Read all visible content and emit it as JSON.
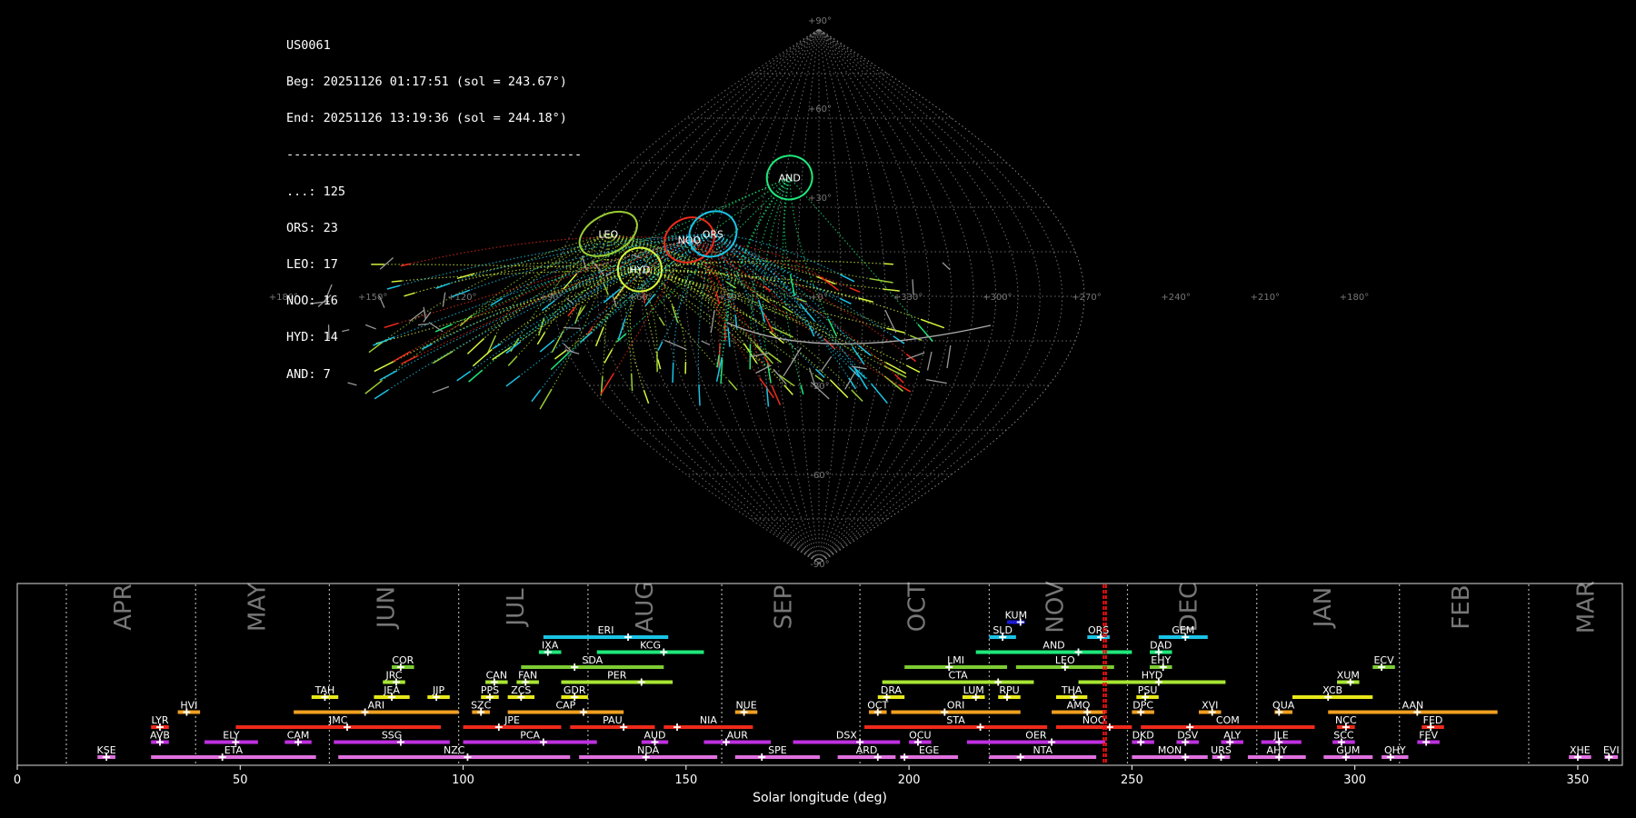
{
  "summary": {
    "station": "US0061",
    "begin": "Beg: 20251126 01:17:51 (sol = 243.67°)",
    "end": "End: 20251126 13:19:36 (sol = 244.18°)",
    "separator": "----------------------------------------",
    "counts": [
      "...: 125",
      "ORS: 23",
      "LEO: 17",
      "NOO: 16",
      "HYD: 14",
      "AND: 7"
    ]
  },
  "chart_data": [
    {
      "type": "scatter",
      "projection": "sinusoidal",
      "grid": true,
      "lon_ticks": [
        "+180°",
        "+150°",
        "+120°",
        "+90°",
        "+60°",
        "+30°",
        "+0°",
        "+330°",
        "+300°",
        "+270°",
        "+240°",
        "+210°",
        "+180°"
      ],
      "lat_ticks": [
        "+90°",
        "+60°",
        "+30°",
        "-30°",
        "-60°",
        "-90°"
      ],
      "colors": {
        "LEO": "#9acd32",
        "HYD": "#d4f53c",
        "NOO": "#ee2a1b",
        "ORS": "#19c4e6",
        "AND": "#1ee87a",
        "sporadic": "#999999"
      },
      "radiants": [
        {
          "code": "LEO",
          "lon": 153,
          "lat": 21
        },
        {
          "code": "HYD",
          "lon": 123,
          "lat": 9
        },
        {
          "code": "NOO",
          "lon": 93,
          "lat": 19
        },
        {
          "code": "ORS",
          "lon": 77,
          "lat": 21
        },
        {
          "code": "AND",
          "lon": 26,
          "lat": 40
        }
      ]
    },
    {
      "type": "bar",
      "title": "",
      "xlabel": "Solar longitude (deg)",
      "ylabel": "",
      "xlim": [
        0,
        360
      ],
      "xticks": [
        0,
        50,
        100,
        150,
        200,
        250,
        300,
        350
      ],
      "current_sol": [
        243.67,
        244.18
      ],
      "months": [
        {
          "name": "APR",
          "lon": 24
        },
        {
          "name": "MAY",
          "lon": 54
        },
        {
          "name": "JUN",
          "lon": 83
        },
        {
          "name": "JUL",
          "lon": 112
        },
        {
          "name": "AUG",
          "lon": 141
        },
        {
          "name": "SEP",
          "lon": 172
        },
        {
          "name": "OCT",
          "lon": 202
        },
        {
          "name": "NOV",
          "lon": 233
        },
        {
          "name": "DEC",
          "lon": 263
        },
        {
          "name": "JAN",
          "lon": 293
        },
        {
          "name": "FEB",
          "lon": 324
        },
        {
          "name": "MAR",
          "lon": 352
        }
      ],
      "month_boundaries": [
        11,
        40,
        70,
        99,
        128,
        158,
        189,
        218,
        249,
        278,
        310,
        339
      ],
      "showers": [
        {
          "code": "KUM",
          "start": 222,
          "end": 226,
          "peak": 225,
          "row": 9,
          "color": "#1a1ad8"
        },
        {
          "code": "ERI",
          "start": 118,
          "end": 146,
          "peak": 137,
          "row": 8,
          "color": "#19c4e6"
        },
        {
          "code": "SLD",
          "start": 218,
          "end": 224,
          "peak": 221,
          "row": 8,
          "color": "#19c4e6"
        },
        {
          "code": "ORS",
          "start": 240,
          "end": 245,
          "peak": 243,
          "row": 8,
          "color": "#19c4e6"
        },
        {
          "code": "GEM",
          "start": 256,
          "end": 267,
          "peak": 262,
          "row": 8,
          "color": "#19c4e6"
        },
        {
          "code": "IXA",
          "start": 117,
          "end": 122,
          "peak": 119,
          "row": 7,
          "color": "#1ee87a"
        },
        {
          "code": "KCG",
          "start": 130,
          "end": 154,
          "peak": 145,
          "row": 7,
          "color": "#1ee87a"
        },
        {
          "code": "AND",
          "start": 215,
          "end": 250,
          "peak": 238,
          "row": 7,
          "color": "#1ee87a"
        },
        {
          "code": "DAD",
          "start": 254,
          "end": 259,
          "peak": 256,
          "row": 7,
          "color": "#1ee87a"
        },
        {
          "code": "COR",
          "start": 84,
          "end": 89,
          "peak": 86,
          "row": 6,
          "color": "#7ccd32"
        },
        {
          "code": "SDA",
          "start": 113,
          "end": 145,
          "peak": 125,
          "row": 6,
          "color": "#7ccd32"
        },
        {
          "code": "LMI",
          "start": 199,
          "end": 222,
          "peak": 209,
          "row": 6,
          "color": "#7ccd32"
        },
        {
          "code": "LEO",
          "start": 224,
          "end": 246,
          "peak": 235,
          "row": 6,
          "color": "#7ccd32"
        },
        {
          "code": "EHY",
          "start": 254,
          "end": 259,
          "peak": 257,
          "row": 6,
          "color": "#7ccd32"
        },
        {
          "code": "ECV",
          "start": 304,
          "end": 309,
          "peak": 306,
          "row": 6,
          "color": "#7ccd32"
        },
        {
          "code": "JRC",
          "start": 82,
          "end": 87,
          "peak": 85,
          "row": 5,
          "color": "#a8e632"
        },
        {
          "code": "CAN",
          "start": 105,
          "end": 110,
          "peak": 107,
          "row": 5,
          "color": "#a8e632"
        },
        {
          "code": "FAN",
          "start": 112,
          "end": 117,
          "peak": 114,
          "row": 5,
          "color": "#a8e632"
        },
        {
          "code": "PER",
          "start": 122,
          "end": 147,
          "peak": 140,
          "row": 5,
          "color": "#a8e632"
        },
        {
          "code": "CTA",
          "start": 194,
          "end": 228,
          "peak": 220,
          "row": 5,
          "color": "#a8e632"
        },
        {
          "code": "HYD",
          "start": 238,
          "end": 271,
          "peak": 256,
          "row": 5,
          "color": "#a8e632"
        },
        {
          "code": "XUM",
          "start": 296,
          "end": 301,
          "peak": 299,
          "row": 5,
          "color": "#a8e632"
        },
        {
          "code": "TAH",
          "start": 66,
          "end": 72,
          "peak": 69,
          "row": 4,
          "color": "#e8e81a"
        },
        {
          "code": "JEA",
          "start": 80,
          "end": 88,
          "peak": 84,
          "row": 4,
          "color": "#e8e81a"
        },
        {
          "code": "JIP",
          "start": 92,
          "end": 97,
          "peak": 94,
          "row": 4,
          "color": "#e8e81a"
        },
        {
          "code": "PPS",
          "start": 104,
          "end": 108,
          "peak": 106,
          "row": 4,
          "color": "#e8e81a"
        },
        {
          "code": "ZCS",
          "start": 110,
          "end": 116,
          "peak": 113,
          "row": 4,
          "color": "#e8e81a"
        },
        {
          "code": "GDR",
          "start": 122,
          "end": 128,
          "peak": 125,
          "row": 4,
          "color": "#e8e81a"
        },
        {
          "code": "DRA",
          "start": 193,
          "end": 199,
          "peak": 195,
          "row": 4,
          "color": "#e8e81a"
        },
        {
          "code": "LUM",
          "start": 212,
          "end": 217,
          "peak": 215,
          "row": 4,
          "color": "#e8e81a"
        },
        {
          "code": "RPU",
          "start": 220,
          "end": 225,
          "peak": 222,
          "row": 4,
          "color": "#e8e81a"
        },
        {
          "code": "THA",
          "start": 233,
          "end": 240,
          "peak": 237,
          "row": 4,
          "color": "#e8e81a"
        },
        {
          "code": "PSU",
          "start": 251,
          "end": 256,
          "peak": 253,
          "row": 4,
          "color": "#e8e81a"
        },
        {
          "code": "XCB",
          "start": 286,
          "end": 304,
          "peak": 294,
          "row": 4,
          "color": "#e8e81a"
        },
        {
          "code": "HVI",
          "start": 36,
          "end": 41,
          "peak": 38,
          "row": 3,
          "color": "#f0a020"
        },
        {
          "code": "ARI",
          "start": 62,
          "end": 99,
          "peak": 78,
          "row": 3,
          "color": "#f0a020"
        },
        {
          "code": "SZC",
          "start": 102,
          "end": 106,
          "peak": 104,
          "row": 3,
          "color": "#f0a020"
        },
        {
          "code": "CAP",
          "start": 110,
          "end": 136,
          "peak": 127,
          "row": 3,
          "color": "#f0a020"
        },
        {
          "code": "NUE",
          "start": 161,
          "end": 166,
          "peak": 163,
          "row": 3,
          "color": "#f0a020"
        },
        {
          "code": "OCT",
          "start": 191,
          "end": 195,
          "peak": 193,
          "row": 3,
          "color": "#f0a020"
        },
        {
          "code": "ORI",
          "start": 196,
          "end": 225,
          "peak": 208,
          "row": 3,
          "color": "#f0a020"
        },
        {
          "code": "AMO",
          "start": 232,
          "end": 244,
          "peak": 240,
          "row": 3,
          "color": "#f0a020"
        },
        {
          "code": "DPC",
          "start": 250,
          "end": 255,
          "peak": 252,
          "row": 3,
          "color": "#f0a020"
        },
        {
          "code": "XVI",
          "start": 265,
          "end": 270,
          "peak": 268,
          "row": 3,
          "color": "#f0a020"
        },
        {
          "code": "QUA",
          "start": 282,
          "end": 286,
          "peak": 283,
          "row": 3,
          "color": "#f0a020"
        },
        {
          "code": "AAN",
          "start": 294,
          "end": 332,
          "peak": 314,
          "row": 3,
          "color": "#f0a020"
        },
        {
          "code": "LYR",
          "start": 30,
          "end": 34,
          "peak": 32,
          "row": 2,
          "color": "#ee2a1b"
        },
        {
          "code": "JMC",
          "start": 49,
          "end": 95,
          "peak": 74,
          "row": 2,
          "color": "#ee2a1b"
        },
        {
          "code": "JPE",
          "start": 100,
          "end": 122,
          "peak": 108,
          "row": 2,
          "color": "#ee2a1b"
        },
        {
          "code": "PAU",
          "start": 124,
          "end": 143,
          "peak": 136,
          "row": 2,
          "color": "#ee2a1b"
        },
        {
          "code": "NIA",
          "start": 145,
          "end": 165,
          "peak": 148,
          "row": 2,
          "color": "#ee2a1b"
        },
        {
          "code": "STA",
          "start": 190,
          "end": 231,
          "peak": 216,
          "row": 2,
          "color": "#ee2a1b"
        },
        {
          "code": "NOO",
          "start": 233,
          "end": 250,
          "peak": 245,
          "row": 2,
          "color": "#ee2a1b"
        },
        {
          "code": "COM",
          "start": 252,
          "end": 291,
          "peak": 263,
          "row": 2,
          "color": "#ee2a1b"
        },
        {
          "code": "NCC",
          "start": 296,
          "end": 300,
          "peak": 298,
          "row": 2,
          "color": "#ee2a1b"
        },
        {
          "code": "FED",
          "start": 315,
          "end": 320,
          "peak": 317,
          "row": 2,
          "color": "#ee2a1b"
        },
        {
          "code": "AVB",
          "start": 30,
          "end": 34,
          "peak": 32,
          "row": 1,
          "color": "#c030e0"
        },
        {
          "code": "ELY",
          "start": 42,
          "end": 54,
          "peak": 49,
          "row": 1,
          "color": "#c030e0"
        },
        {
          "code": "CAM",
          "start": 60,
          "end": 66,
          "peak": 63,
          "row": 1,
          "color": "#c030e0"
        },
        {
          "code": "SSG",
          "start": 71,
          "end": 97,
          "peak": 86,
          "row": 1,
          "color": "#c030e0"
        },
        {
          "code": "PCA",
          "start": 100,
          "end": 130,
          "peak": 118,
          "row": 1,
          "color": "#c030e0"
        },
        {
          "code": "AUD",
          "start": 140,
          "end": 146,
          "peak": 143,
          "row": 1,
          "color": "#c030e0"
        },
        {
          "code": "AUR",
          "start": 154,
          "end": 169,
          "peak": 159,
          "row": 1,
          "color": "#c030e0"
        },
        {
          "code": "DSX",
          "start": 174,
          "end": 198,
          "peak": 189,
          "row": 1,
          "color": "#c030e0"
        },
        {
          "code": "OCU",
          "start": 200,
          "end": 205,
          "peak": 202,
          "row": 1,
          "color": "#c030e0"
        },
        {
          "code": "OER",
          "start": 213,
          "end": 244,
          "peak": 232,
          "row": 1,
          "color": "#c030e0"
        },
        {
          "code": "DKD",
          "start": 250,
          "end": 255,
          "peak": 252,
          "row": 1,
          "color": "#c030e0"
        },
        {
          "code": "DSV",
          "start": 260,
          "end": 265,
          "peak": 262,
          "row": 1,
          "color": "#c030e0"
        },
        {
          "code": "ALY",
          "start": 270,
          "end": 275,
          "peak": 272,
          "row": 1,
          "color": "#c030e0"
        },
        {
          "code": "JLE",
          "start": 279,
          "end": 288,
          "peak": 283,
          "row": 1,
          "color": "#c030e0"
        },
        {
          "code": "SCC",
          "start": 295,
          "end": 300,
          "peak": 297,
          "row": 1,
          "color": "#c030e0"
        },
        {
          "code": "FEV",
          "start": 314,
          "end": 319,
          "peak": 316,
          "row": 1,
          "color": "#c030e0"
        },
        {
          "code": "KSE",
          "start": 18,
          "end": 22,
          "peak": 20,
          "row": 0,
          "color": "#e070e0"
        },
        {
          "code": "ETA",
          "start": 30,
          "end": 67,
          "peak": 46,
          "row": 0,
          "color": "#e070e0"
        },
        {
          "code": "NZC",
          "start": 72,
          "end": 124,
          "peak": 101,
          "row": 0,
          "color": "#e070e0"
        },
        {
          "code": "NDA",
          "start": 126,
          "end": 157,
          "peak": 141,
          "row": 0,
          "color": "#e070e0"
        },
        {
          "code": "SPE",
          "start": 161,
          "end": 180,
          "peak": 167,
          "row": 0,
          "color": "#e070e0"
        },
        {
          "code": "ARD",
          "start": 184,
          "end": 197,
          "peak": 193,
          "row": 0,
          "color": "#e070e0"
        },
        {
          "code": "EGE",
          "start": 198,
          "end": 211,
          "peak": 199,
          "row": 0,
          "color": "#e070e0"
        },
        {
          "code": "NTA",
          "start": 218,
          "end": 242,
          "peak": 225,
          "row": 0,
          "color": "#e070e0"
        },
        {
          "code": "MON",
          "start": 250,
          "end": 267,
          "peak": 262,
          "row": 0,
          "color": "#e070e0"
        },
        {
          "code": "URS",
          "start": 268,
          "end": 272,
          "peak": 270,
          "row": 0,
          "color": "#e070e0"
        },
        {
          "code": "AHY",
          "start": 276,
          "end": 289,
          "peak": 283,
          "row": 0,
          "color": "#e070e0"
        },
        {
          "code": "GUM",
          "start": 293,
          "end": 304,
          "peak": 298,
          "row": 0,
          "color": "#e070e0"
        },
        {
          "code": "OHY",
          "start": 306,
          "end": 312,
          "peak": 308,
          "row": 0,
          "color": "#e070e0"
        },
        {
          "code": "XHE",
          "start": 348,
          "end": 353,
          "peak": 350,
          "row": 0,
          "color": "#e070e0"
        },
        {
          "code": "EVI",
          "start": 356,
          "end": 359,
          "peak": 357,
          "row": 0,
          "color": "#e070e0"
        }
      ]
    }
  ]
}
